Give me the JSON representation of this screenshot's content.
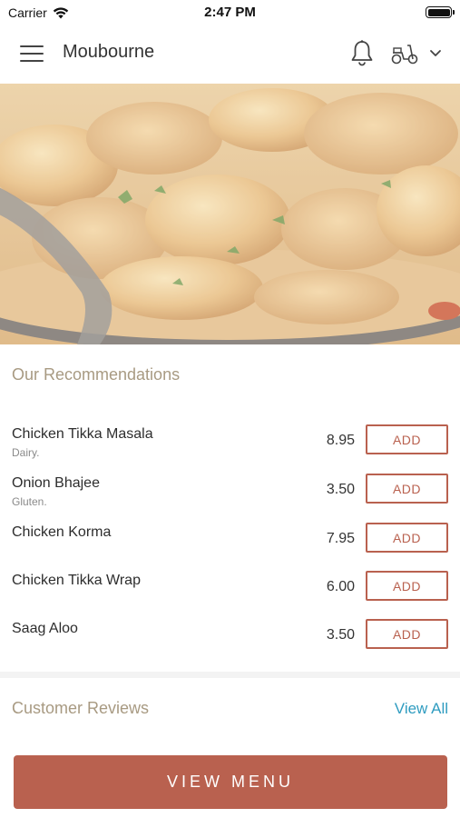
{
  "status_bar": {
    "carrier": "Carrier",
    "time": "2:47 PM"
  },
  "header": {
    "title": "Moubourne",
    "icons": [
      "menu-icon",
      "bell-icon",
      "scooter-icon",
      "chevron-down-icon"
    ]
  },
  "recommendations": {
    "title": "Our Recommendations",
    "items": [
      {
        "name": "Chicken Tikka Masala",
        "tag": "Dairy.",
        "price": "8.95",
        "button": "ADD"
      },
      {
        "name": "Onion Bhajee",
        "tag": "Gluten.",
        "price": "3.50",
        "button": "ADD"
      },
      {
        "name": "Chicken Korma",
        "tag": "",
        "price": "7.95",
        "button": "ADD"
      },
      {
        "name": "Chicken Tikka Wrap",
        "tag": "",
        "price": "6.00",
        "button": "ADD"
      },
      {
        "name": "Saag Aloo",
        "tag": "",
        "price": "3.50",
        "button": "ADD"
      }
    ]
  },
  "reviews": {
    "title": "Customer Reviews",
    "view_all": "View All"
  },
  "cta": {
    "label": "VIEW MENU"
  },
  "colors": {
    "accent": "#b9614f",
    "section_title": "#a89a82",
    "link": "#2f9cc0"
  }
}
